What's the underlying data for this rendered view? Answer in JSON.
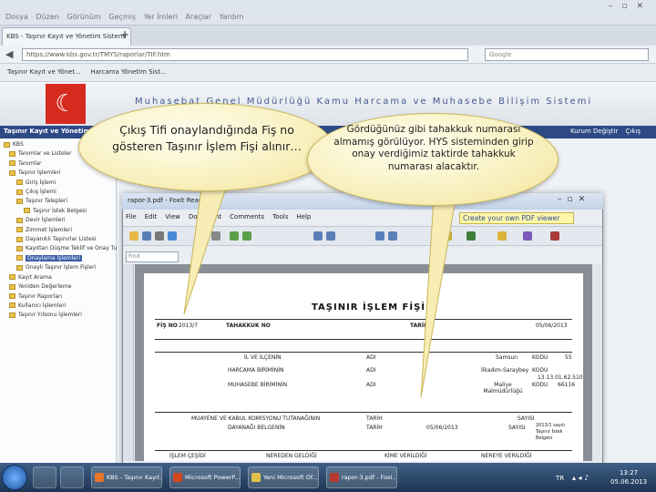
{
  "browser": {
    "menu": [
      "Dosya",
      "Düzen",
      "Görünüm",
      "Geçmiş",
      "Yer İmleri",
      "Araçlar",
      "Yardım"
    ],
    "tab_label": "KBS - Taşınır Kayıt ve Yönetim Sistemi",
    "url": "https://www.kbs.gov.tr/TMYS/raporlar/TIF.htm",
    "search_placeholder": "Google",
    "bookmarks": [
      "Taşınır Kayıt ve Yönet...",
      "Harcama Yönetim Sist..."
    ]
  },
  "site": {
    "title": "Muhasebat Genel Müdürlüğü Kamu Harcama ve Muhasebe Bilişim Sistemi",
    "nav_left": "Taşınır Kayıt ve Yönetim",
    "nav_right": [
      "Kurum Değiştir",
      "Çıkış"
    ]
  },
  "tree": [
    "KBS",
    "Tanımlar ve Listeler",
    "Tanımlar",
    "Taşınır İşlemleri",
    "Giriş İşlemi",
    "Çıkış İşlemi",
    "Taşınır Talepleri",
    "Taşınır İstek Belgesi",
    "Devir İşlemleri",
    "Zimmet İşlemleri",
    "Dayanıklı Taşınırlar Listesi",
    "Kayıttan Düşme Teklif ve Onay Tutanağı",
    "Onaylama İşlemleri",
    "Onaylı Taşınır İşlem Fişleri",
    "Kayıt Arama",
    "Yeniden Değerleme",
    "Taşınır Raporları",
    "Kullanıcı İşlemleri",
    "Taşınır Yılsonu İşlemleri"
  ],
  "pdf": {
    "title": "rapor-3.pdf - Foxit Reader",
    "menu": [
      "File",
      "Edit",
      "View",
      "Document",
      "Comments",
      "Tools",
      "Help"
    ],
    "promo": "Create your own PDF viewer",
    "find_placeholder": "Find",
    "doc": {
      "title": "TAŞINIR İŞLEM FİŞİ",
      "fis_no_label": "FİŞ NO",
      "fis_no_value": "2013/7",
      "tahakkuk_no_label": "TAHAKKUK NO",
      "tarih_label": "TARİH",
      "tarih_value": "05/06/2013",
      "row_labels": [
        "İL VE İLÇENİN",
        "HARCAMA BİRİMİNİN",
        "MUHASEBE BİRİMİNİN"
      ],
      "row_adi": [
        "ADI",
        "ADI",
        "ADI"
      ],
      "row_values": [
        "Samsun",
        "İlkadım-Saraybey",
        "Maliye Malmüdürlüğü"
      ],
      "row_kodu": [
        "KODU",
        "KODU",
        "KODU"
      ],
      "row_codes": [
        "55",
        "13.13.01.62.510",
        "66116"
      ],
      "muayene_label": "MUAYENE VE KABUL KOMİSYONU TUTANAĞININ",
      "muayene_tarih": "TARİH",
      "muayene_sayi": "SAYISI",
      "dayanak_label": "DAYANAĞI BELGENİN",
      "dayanak_tarih": "TARİH",
      "dayanak_tarih_value": "05/06/2013",
      "dayanak_sayi": "SAYISI",
      "dayanak_sayi_value": "2013/1 sayılı Taşınır İstek Belgesi",
      "footer": [
        "İŞLEM ÇEŞİDİ",
        "NEREDEN GELDİĞİ",
        "KİME VERİLDİĞİ",
        "NEREYE VERİLDİĞİ"
      ]
    }
  },
  "callouts": {
    "left": "Çıkış Tifi onaylandığında Fiş no gösteren Taşınır İşlem Fişi alınır…",
    "right": "Gördüğünüz gibi tahakkuk numarası almamış görülüyor. HYS sisteminden girip onay verdiğimiz taktirde tahakkuk numarası alacaktır."
  },
  "taskbar": {
    "items": [
      "KBS - Taşınır Kayıt...",
      "Microsoft PowerP...",
      "Yeni Microsoft Of...",
      "rapor-3.pdf - Foxi..."
    ],
    "lang": "TR",
    "time": "13:27",
    "date": "05.06.2013"
  },
  "colors": {
    "callout_fill": "#f7edb5",
    "site_nav": "#2d4a86",
    "flag": "#d52b1e",
    "taskbar": "#1e3552"
  }
}
